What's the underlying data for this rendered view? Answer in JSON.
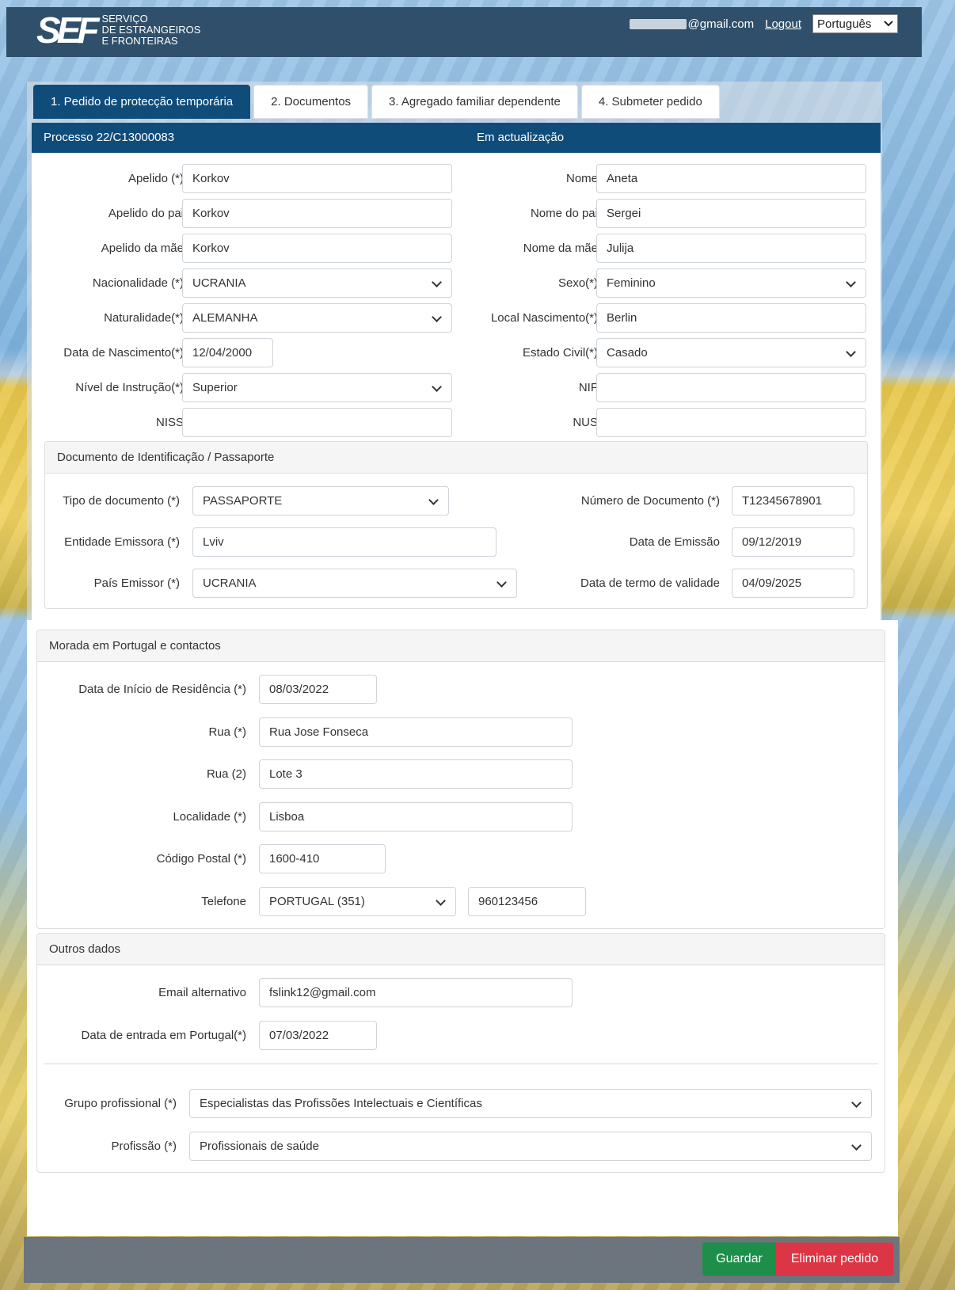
{
  "header": {
    "logo_mark": "SEF",
    "logo_line1": "Serviço",
    "logo_line2": "de Estrangeiros",
    "logo_line3": "e Fronteiras",
    "email_suffix": "@gmail.com",
    "logout": "Logout",
    "language": "Português"
  },
  "tabs": [
    {
      "label": "1. Pedido de protecção temporária"
    },
    {
      "label": "2. Documentos"
    },
    {
      "label": "3. Agregado familiar dependente"
    },
    {
      "label": "4. Submeter pedido"
    }
  ],
  "process": {
    "number": "Processo 22/C13000083",
    "status": "Em actualização"
  },
  "personal": {
    "apelido": {
      "label": "Apelido (*)",
      "value": "Korkov"
    },
    "apelido_pai": {
      "label": "Apelido do pai",
      "value": "Korkov"
    },
    "apelido_mae": {
      "label": "Apelido da mãe",
      "value": "Korkov"
    },
    "nacionalidade": {
      "label": "Nacionalidade (*)",
      "value": "UCRANIA"
    },
    "naturalidade": {
      "label": "Naturalidade(*)",
      "value": "ALEMANHA"
    },
    "data_nascimento": {
      "label": "Data de Nascimento(*)",
      "value": "12/04/2000"
    },
    "nivel_instrucao": {
      "label": "Nível de Instrução(*)",
      "value": "Superior"
    },
    "niss": {
      "label": "NISS",
      "value": ""
    },
    "nome": {
      "label": "Nome",
      "value": "Aneta"
    },
    "nome_pai": {
      "label": "Nome do pai",
      "value": "Sergei"
    },
    "nome_mae": {
      "label": "Nome da mãe",
      "value": "Julija"
    },
    "sexo": {
      "label": "Sexo(*)",
      "value": "Feminino"
    },
    "local_nascimento": {
      "label": "Local Nascimento(*)",
      "value": "Berlin"
    },
    "estado_civil": {
      "label": "Estado Civil(*)",
      "value": "Casado"
    },
    "nif": {
      "label": "NIF",
      "value": ""
    },
    "nus": {
      "label": "NUS",
      "value": ""
    }
  },
  "document": {
    "title": "Documento de Identificação / Passaporte",
    "tipo": {
      "label": "Tipo de documento (*)",
      "value": "PASSAPORTE"
    },
    "entidade": {
      "label": "Entidade Emissora (*)",
      "value": "Lviv"
    },
    "pais": {
      "label": "País Emissor (*)",
      "value": "UCRANIA"
    },
    "numero": {
      "label": "Número de Documento (*)",
      "value": "T12345678901"
    },
    "emissao": {
      "label": "Data de Emissão",
      "value": "09/12/2019"
    },
    "validade": {
      "label": "Data de termo de validade",
      "value": "04/09/2025"
    }
  },
  "address": {
    "title": "Morada em Portugal e contactos",
    "inicio": {
      "label": "Data de Início de Residência (*)",
      "value": "08/03/2022"
    },
    "rua": {
      "label": "Rua (*)",
      "value": "Rua Jose Fonseca"
    },
    "rua2": {
      "label": "Rua (2)",
      "value": "Lote 3"
    },
    "localidade": {
      "label": "Localidade (*)",
      "value": "Lisboa"
    },
    "codigo_postal": {
      "label": "Código Postal (*)",
      "value": "1600-410"
    },
    "telefone": {
      "label": "Telefone",
      "country": "PORTUGAL (351)",
      "value": "960123456"
    }
  },
  "other": {
    "title": "Outros dados",
    "email": {
      "label": "Email alternativo",
      "value": "fslink12@gmail.com"
    },
    "entrada": {
      "label": "Data de entrada em Portugal(*)",
      "value": "07/03/2022"
    },
    "grupo": {
      "label": "Grupo profissional (*)",
      "value": "Especialistas das Profissões Intelectuais e Científicas"
    },
    "profissao": {
      "label": "Profissão (*)",
      "value": "Profissionais de saúde"
    }
  },
  "actions": {
    "save": "Guardar",
    "delete": "Eliminar pedido"
  }
}
